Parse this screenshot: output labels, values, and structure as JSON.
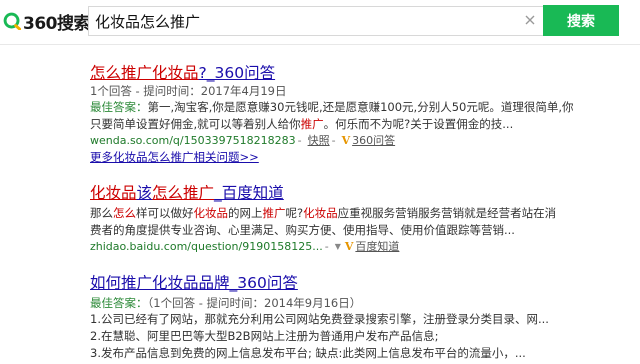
{
  "search": {
    "query": "化妆品怎么推广",
    "button_label": "搜索"
  },
  "logo": {
    "text": "360搜索"
  },
  "results": [
    {
      "title_parts": [
        "怎么推广化妆品",
        "?_360问答"
      ],
      "meta": "1个回答 - 提问时间：2017年4月19日",
      "best_label": "最佳答案：",
      "abstract_line1": "第一,淘宝客,你是愿意赚30元钱呢,还是愿意赚100元,分别人50元呢。道理很简单,你",
      "abstract_line2_a": "只要简单设置好佣金,就可以等着别人给你",
      "abstract_line2_hl": "推广",
      "abstract_line2_b": "。何乐而不为呢?关于设置佣金的技...",
      "url": "wenda.so.com/q/1503397518218283",
      "snapshot_label": "快照",
      "site_name": "360问答",
      "more_link": "更多化妆品怎么推广相关问题>>"
    },
    {
      "title_parts": [
        "化妆品",
        "该",
        "怎么推广",
        "_百度知道"
      ],
      "abstract_line1_parts": [
        "那么",
        "怎么",
        "样可以做好",
        "化妆品",
        "的网上",
        "推广",
        "呢?",
        "化妆品",
        "应重视服务营销服务营销就是经营者站在消"
      ],
      "abstract_line2": "费者的角度提供专业咨询、心里满足、购买方便、使用指导、使用价值跟踪等营销...",
      "url": "zhidao.baidu.com/question/9190158125...",
      "site_name": "百度知道"
    },
    {
      "title_parts": [
        "如何推广化妆品",
        "品牌_360问答"
      ],
      "best_label": "最佳答案：",
      "meta": "（1个回答 - 提问时间：2014年9月16日）",
      "line1": "1.公司已经有了网站，那就充分利用公司网站免费登录搜索引擎，注册登录分类目录、网...",
      "line2": "2.在慧聪、阿里巴巴等大型B2B网站上注册为普通用户发布产品信息;",
      "line3": "3.发布产品信息到免费的网上信息发布平台; 缺点:此类网上信息发布平台的流量小，..."
    }
  ],
  "colors": {
    "accent": "#19b955",
    "link": "#1a0dab",
    "highlight": "#cc0000",
    "url": "#1f7a2a",
    "badge": "#e69500"
  }
}
